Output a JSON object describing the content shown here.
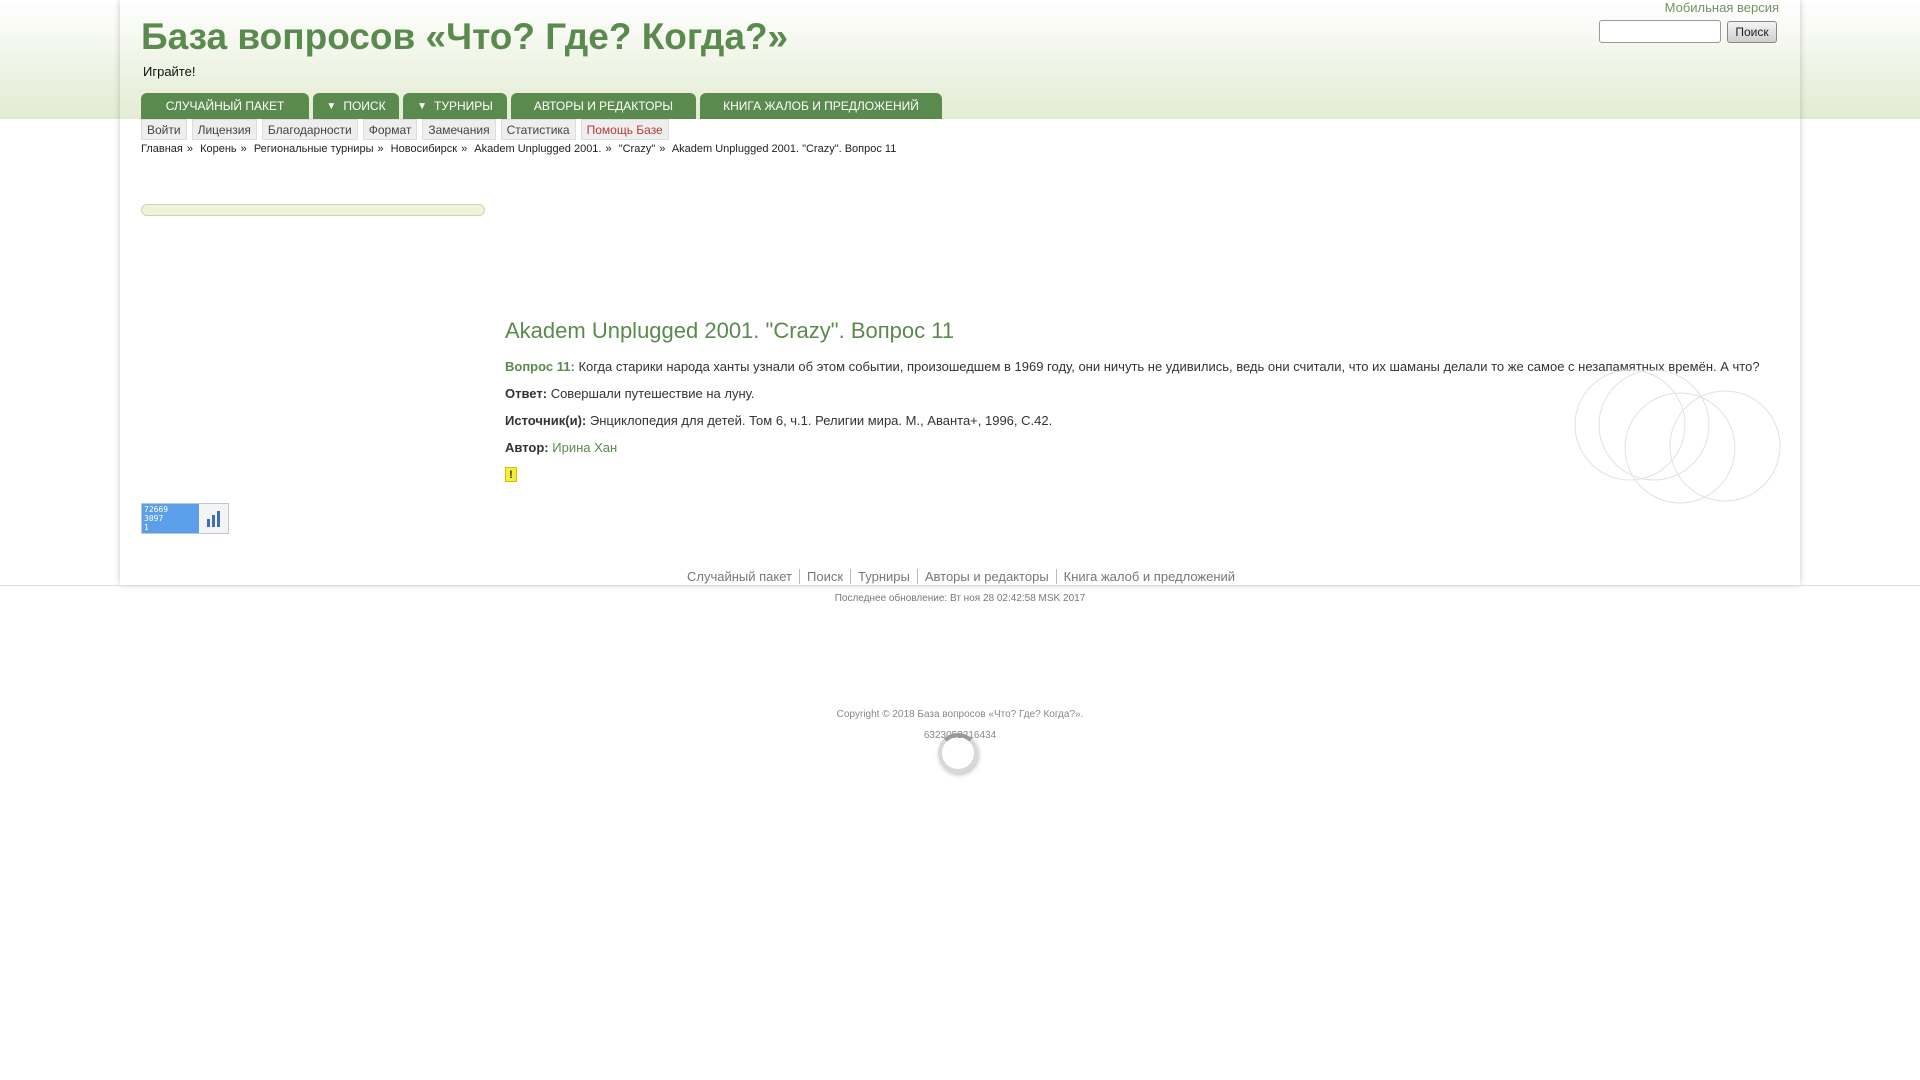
{
  "header": {
    "site_title": "База вопросов «Что? Где? Когда?»",
    "tagline": "Играйте!",
    "mobile_link": "Мобильная версия",
    "search_button": "Поиск",
    "search_value": ""
  },
  "main_menu": [
    {
      "label": "Случайный пакет",
      "has_arrow": false
    },
    {
      "label": "Поиск",
      "has_arrow": true
    },
    {
      "label": "Турниры",
      "has_arrow": true
    },
    {
      "label": "Авторы и редакторы",
      "has_arrow": false
    },
    {
      "label": "Книга жалоб и предложений",
      "has_arrow": false
    }
  ],
  "sub_menu": [
    "Войти",
    "Лицензия",
    "Благодарности",
    "Формат",
    "Замечания",
    "Статистика",
    "Помощь Базе"
  ],
  "breadcrumb": [
    "Главная",
    "Корень",
    "Региональные турниры",
    "Новосибирск",
    "Akadem Unplugged 2001.",
    "\"Crazy\"",
    "Akadem Unplugged 2001. \"Crazy\". Вопрос 11"
  ],
  "question": {
    "title": "Akadem Unplugged 2001. \"Crazy\". Вопрос 11",
    "number_label": "Вопрос 11:",
    "text": "Когда старики народа ханты узнали об этом событии, произошедшем в 1969 году, они ничуть не удивились, ведь они считали, что их шаманы делали то же самое с незапамятных времён. А что?",
    "answer_label": "Ответ:",
    "answer": "Совершали путешествие на луну.",
    "source_label": "Источник(и):",
    "source": "Энциклопедия для детей. Том 6, ч.1. Религии мира. М., Аванта+, 1996, С.42.",
    "author_label": "Автор:",
    "author": "Ирина Хан",
    "warning_mark": "!"
  },
  "counter": [
    "72669",
    "3097",
    "1"
  ],
  "footer": {
    "nav": [
      "Случайный пакет",
      "Поиск",
      "Турниры",
      "Авторы и редакторы",
      "Книга жалоб и предложений"
    ],
    "updated": "Последнее обновление: Вт ноя 28 02:42:58 MSK 2017",
    "copyright": "Copyright © 2018 База вопросов «Что? Где? Когда?».",
    "hash": "6323052216434"
  },
  "colors": {
    "accent": "#5b8a4e",
    "menu_text": "#ffffff",
    "help_red": "#b43b3b"
  },
  "icons": [
    "chart-icon",
    "warning-icon",
    "spinner-icon"
  ]
}
